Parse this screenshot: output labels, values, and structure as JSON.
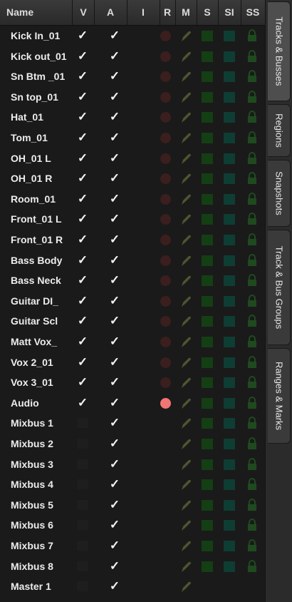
{
  "headers": [
    "Name",
    "V",
    "A",
    "I",
    "R",
    "M",
    "S",
    "SI",
    "SS"
  ],
  "tracks": [
    {
      "name": "Kick In_01",
      "v": true,
      "a": true,
      "rec": "off"
    },
    {
      "name": "Kick out_01",
      "v": true,
      "a": true,
      "rec": "off"
    },
    {
      "name": "Sn Btm _01",
      "v": true,
      "a": true,
      "rec": "off"
    },
    {
      "name": "Sn top_01",
      "v": true,
      "a": true,
      "rec": "off"
    },
    {
      "name": "Hat_01",
      "v": true,
      "a": true,
      "rec": "off"
    },
    {
      "name": "Tom_01",
      "v": true,
      "a": true,
      "rec": "off"
    },
    {
      "name": "OH_01 L",
      "v": true,
      "a": true,
      "rec": "off"
    },
    {
      "name": "OH_01 R",
      "v": true,
      "a": true,
      "rec": "off"
    },
    {
      "name": "Room_01",
      "v": true,
      "a": true,
      "rec": "off"
    },
    {
      "name": "Front_01 L",
      "v": true,
      "a": true,
      "rec": "off"
    },
    {
      "name": "Front_01 R",
      "v": true,
      "a": true,
      "rec": "off"
    },
    {
      "name": "Bass Body",
      "v": true,
      "a": true,
      "rec": "off"
    },
    {
      "name": "Bass Neck",
      "v": true,
      "a": true,
      "rec": "off"
    },
    {
      "name": "Guitar DI_",
      "v": true,
      "a": true,
      "rec": "off"
    },
    {
      "name": "Guitar Scl",
      "v": true,
      "a": true,
      "rec": "off"
    },
    {
      "name": "Matt Vox_",
      "v": true,
      "a": true,
      "rec": "off"
    },
    {
      "name": "Vox 2_01",
      "v": true,
      "a": true,
      "rec": "off"
    },
    {
      "name": "Vox 3_01",
      "v": true,
      "a": true,
      "rec": "off"
    },
    {
      "name": "Audio",
      "v": true,
      "a": true,
      "rec": "armed"
    },
    {
      "name": "Mixbus 1",
      "v": false,
      "a": true,
      "rec": "none"
    },
    {
      "name": "Mixbus 2",
      "v": false,
      "a": true,
      "rec": "none"
    },
    {
      "name": "Mixbus 3",
      "v": false,
      "a": true,
      "rec": "none"
    },
    {
      "name": "Mixbus 4",
      "v": false,
      "a": true,
      "rec": "none"
    },
    {
      "name": "Mixbus 5",
      "v": false,
      "a": true,
      "rec": "none"
    },
    {
      "name": "Mixbus 6",
      "v": false,
      "a": true,
      "rec": "none"
    },
    {
      "name": "Mixbus 7",
      "v": false,
      "a": true,
      "rec": "none"
    },
    {
      "name": "Mixbus 8",
      "v": false,
      "a": true,
      "rec": "none"
    },
    {
      "name": "Master 1",
      "v": false,
      "a": true,
      "rec": "none",
      "master": true
    }
  ],
  "tabs": [
    {
      "label": "Tracks & Busses",
      "active": true
    },
    {
      "label": "Regions",
      "active": false
    },
    {
      "label": "Snapshots",
      "active": false
    },
    {
      "label": "Track & Bus Groups",
      "active": false
    },
    {
      "label": "Ranges & Marks",
      "active": false
    }
  ],
  "colors": {
    "rec_off": "#3b1e1e",
    "rec_armed": "#f07575",
    "mute_icon": "#4d5530",
    "solo": "#143f14",
    "solo_isolate": "#0e3d33",
    "solo_safe_lock": "#1f4a1f"
  },
  "icons": {
    "check": "✓",
    "mute": "mute-pencil-icon",
    "solo_safe": "lock-icon"
  }
}
